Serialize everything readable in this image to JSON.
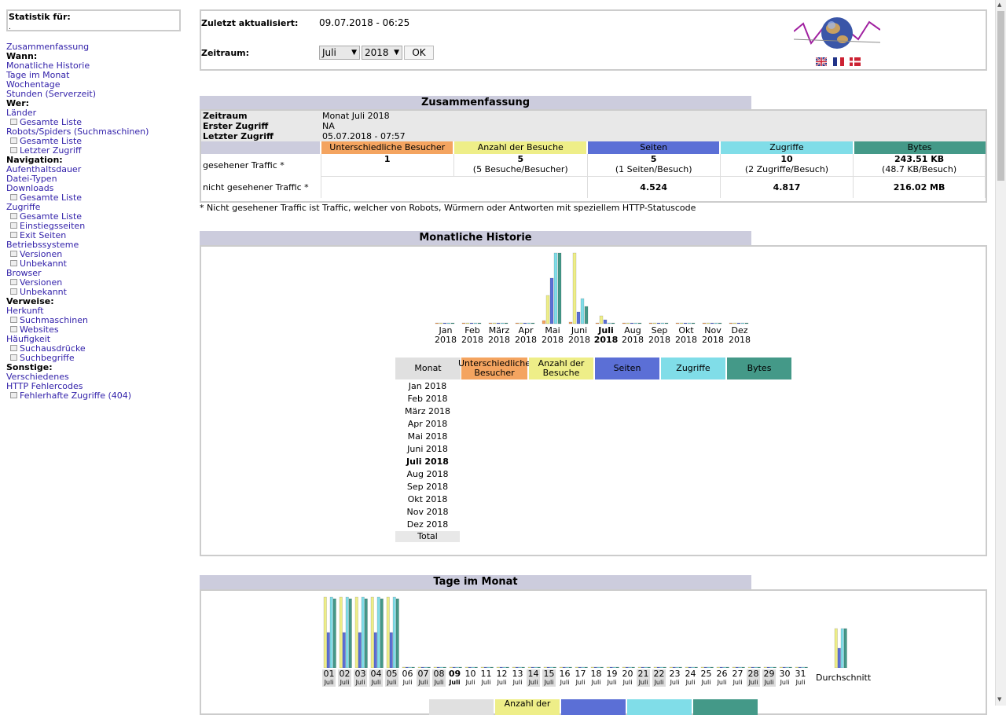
{
  "sidebar": {
    "stat_label": "Statistik für:",
    "stat_value": ".",
    "items": [
      {
        "label": "Zusammenfassung",
        "type": "link"
      },
      {
        "label": "Wann:",
        "type": "head"
      },
      {
        "label": "Monatliche Historie",
        "type": "link"
      },
      {
        "label": "Tage im Monat",
        "type": "link"
      },
      {
        "label": "Wochentage",
        "type": "link"
      },
      {
        "label": "Stunden (Serverzeit)",
        "type": "link"
      },
      {
        "label": "Wer:",
        "type": "head"
      },
      {
        "label": "Länder",
        "type": "link"
      },
      {
        "label": "Gesamte Liste",
        "type": "sub"
      },
      {
        "label": "Robots/Spiders (Suchmaschinen)",
        "type": "link"
      },
      {
        "label": "Gesamte Liste",
        "type": "sub"
      },
      {
        "label": "Letzter Zugriff",
        "type": "sub"
      },
      {
        "label": "Navigation:",
        "type": "head"
      },
      {
        "label": "Aufenthaltsdauer",
        "type": "link"
      },
      {
        "label": "Datei-Typen",
        "type": "link"
      },
      {
        "label": "Downloads",
        "type": "link"
      },
      {
        "label": "Gesamte Liste",
        "type": "sub"
      },
      {
        "label": "Zugriffe",
        "type": "link"
      },
      {
        "label": "Gesamte Liste",
        "type": "sub"
      },
      {
        "label": "Einstiegsseiten",
        "type": "sub"
      },
      {
        "label": "Exit Seiten",
        "type": "sub"
      },
      {
        "label": "Betriebssysteme",
        "type": "link"
      },
      {
        "label": "Versionen",
        "type": "sub"
      },
      {
        "label": "Unbekannt",
        "type": "sub"
      },
      {
        "label": "Browser",
        "type": "link"
      },
      {
        "label": "Versionen",
        "type": "sub"
      },
      {
        "label": "Unbekannt",
        "type": "sub"
      },
      {
        "label": "Verweise:",
        "type": "head"
      },
      {
        "label": "Herkunft",
        "type": "link"
      },
      {
        "label": "Suchmaschinen",
        "type": "sub"
      },
      {
        "label": "Websites",
        "type": "sub"
      },
      {
        "label": "Häufigkeit",
        "type": "link"
      },
      {
        "label": "Suchausdrücke",
        "type": "sub"
      },
      {
        "label": "Suchbegriffe",
        "type": "sub"
      },
      {
        "label": "Sonstige:",
        "type": "head"
      },
      {
        "label": "Verschiedenes",
        "type": "link"
      },
      {
        "label": "HTTP Fehlercodes",
        "type": "link"
      },
      {
        "label": "Fehlerhafte Zugriffe (404)",
        "type": "sub"
      }
    ]
  },
  "top": {
    "updated_label": "Zuletzt aktualisiert:",
    "updated_value": "09.07.2018 - 06:25",
    "period_label": "Zeitraum:",
    "month_value": "Juli",
    "year_value": "2018",
    "ok_label": "OK"
  },
  "summary": {
    "title": "Zusammenfassung",
    "rows": [
      {
        "label": "Zeitraum",
        "value": "Monat Juli 2018"
      },
      {
        "label": "Erster Zugriff",
        "value": "NA"
      },
      {
        "label": "Letzter Zugriff",
        "value": "05.07.2018 - 07:57"
      }
    ],
    "headers": [
      "Unterschiedliche Besucher",
      "Anzahl der Besuche",
      "Seiten",
      "Zugriffe",
      "Bytes"
    ],
    "seen_label": "gesehener Traffic *",
    "seen": [
      {
        "main": "1",
        "sub": ""
      },
      {
        "main": "5",
        "sub": "(5 Besuche/Besucher)"
      },
      {
        "main": "5",
        "sub": "(1 Seiten/Besuch)"
      },
      {
        "main": "10",
        "sub": "(2 Zugriffe/Besuch)"
      },
      {
        "main": "243.51 KB",
        "sub": "(48.7 KB/Besuch)"
      }
    ],
    "unseen_label": "nicht gesehener Traffic *",
    "unseen": [
      "4.524",
      "4.817",
      "216.02 MB"
    ],
    "note": "* Nicht gesehener Traffic ist Traffic, welcher von Robots, Würmern oder Antworten mit speziellem HTTP-Statuscode"
  },
  "colors": {
    "visitors": "#f4a460",
    "visits": "#eeee88",
    "pages": "#5b6fd6",
    "hits": "#80dde8",
    "bytes": "#449988",
    "title_bg": "#ccccdd"
  },
  "monthly": {
    "title": "Monatliche Historie",
    "months": [
      "Jan",
      "Feb",
      "März",
      "Apr",
      "Mai",
      "Juni",
      "Juli",
      "Aug",
      "Sep",
      "Okt",
      "Nov",
      "Dez"
    ],
    "year": "2018",
    "current_index": 6,
    "table_header": [
      "Monat",
      "Unterschiedliche Besucher",
      "Anzahl der Besuche",
      "Seiten",
      "Zugriffe",
      "Bytes"
    ],
    "rows": [
      "Jan 2018",
      "Feb 2018",
      "März 2018",
      "Apr 2018",
      "Mai 2018",
      "Juni 2018",
      "Juli 2018",
      "Aug 2018",
      "Sep 2018",
      "Okt 2018",
      "Nov 2018",
      "Dez 2018"
    ],
    "total_label": "Total"
  },
  "daily": {
    "title": "Tage im Monat",
    "days": [
      "01",
      "02",
      "03",
      "04",
      "05",
      "06",
      "07",
      "08",
      "09",
      "10",
      "11",
      "12",
      "13",
      "14",
      "15",
      "16",
      "17",
      "18",
      "19",
      "20",
      "21",
      "22",
      "23",
      "24",
      "25",
      "26",
      "27",
      "28",
      "29",
      "30",
      "31"
    ],
    "month_short": "Juli",
    "weekend": [
      "07",
      "08",
      "14",
      "15",
      "21",
      "22",
      "28",
      "29"
    ],
    "highlight_days": [
      "01",
      "02",
      "03",
      "04",
      "05"
    ],
    "current_day": "09",
    "average_label": "Durchschnitt",
    "table_header_partial": "Anzahl der"
  },
  "chart_data": [
    {
      "type": "bar",
      "title": "Monatliche Historie",
      "categories": [
        "Jan 2018",
        "Feb 2018",
        "März 2018",
        "Apr 2018",
        "Mai 2018",
        "Juni 2018",
        "Juli 2018",
        "Aug 2018",
        "Sep 2018",
        "Okt 2018",
        "Nov 2018",
        "Dez 2018"
      ],
      "series": [
        {
          "name": "Unterschiedliche Besucher",
          "values": [
            0,
            0,
            0,
            0,
            4,
            2,
            1,
            0,
            0,
            0,
            0,
            0
          ]
        },
        {
          "name": "Anzahl der Besuche",
          "values": [
            0,
            0,
            0,
            0,
            36,
            90,
            10,
            0,
            0,
            0,
            0,
            0
          ]
        },
        {
          "name": "Seiten",
          "values": [
            0,
            0,
            0,
            0,
            58,
            15,
            5,
            0,
            0,
            0,
            0,
            0
          ]
        },
        {
          "name": "Zugriffe",
          "values": [
            0,
            0,
            0,
            0,
            90,
            32,
            1,
            0,
            0,
            0,
            0,
            0
          ]
        },
        {
          "name": "Bytes",
          "values": [
            0,
            0,
            0,
            0,
            90,
            22,
            1,
            0,
            0,
            0,
            0,
            0
          ]
        }
      ]
    },
    {
      "type": "bar",
      "title": "Tage im Monat",
      "categories": [
        "01",
        "02",
        "03",
        "04",
        "05",
        "06",
        "07",
        "08",
        "09",
        "10",
        "11",
        "12",
        "13",
        "14",
        "15",
        "16",
        "17",
        "18",
        "19",
        "20",
        "21",
        "22",
        "23",
        "24",
        "25",
        "26",
        "27",
        "28",
        "29",
        "30",
        "31",
        "Durchschnitt"
      ],
      "series": [
        {
          "name": "Anzahl der Besuche",
          "values": [
            90,
            90,
            90,
            90,
            90,
            0,
            0,
            0,
            0,
            0,
            0,
            0,
            0,
            0,
            0,
            0,
            0,
            0,
            0,
            0,
            0,
            0,
            0,
            0,
            0,
            0,
            0,
            0,
            0,
            0,
            0,
            50
          ]
        },
        {
          "name": "Seiten",
          "values": [
            45,
            45,
            45,
            45,
            45,
            0,
            0,
            0,
            0,
            0,
            0,
            0,
            0,
            0,
            0,
            0,
            0,
            0,
            0,
            0,
            0,
            0,
            0,
            0,
            0,
            0,
            0,
            0,
            0,
            0,
            0,
            25
          ]
        },
        {
          "name": "Zugriffe",
          "values": [
            90,
            90,
            90,
            90,
            90,
            0,
            0,
            0,
            0,
            0,
            0,
            0,
            0,
            0,
            0,
            0,
            0,
            0,
            0,
            0,
            0,
            0,
            0,
            0,
            0,
            0,
            0,
            0,
            0,
            0,
            0,
            50
          ]
        },
        {
          "name": "Bytes",
          "values": [
            88,
            88,
            88,
            88,
            88,
            0,
            0,
            0,
            0,
            0,
            0,
            0,
            0,
            0,
            0,
            0,
            0,
            0,
            0,
            0,
            0,
            0,
            0,
            0,
            0,
            0,
            0,
            0,
            0,
            0,
            0,
            50
          ]
        }
      ]
    }
  ]
}
